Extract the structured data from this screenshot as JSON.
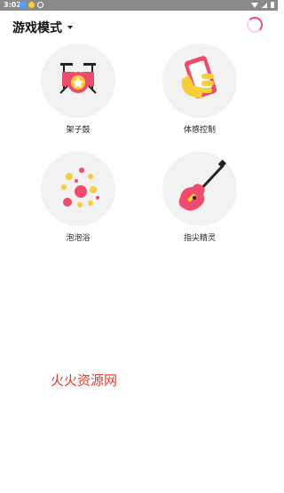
{
  "status_bar": {
    "time": "3:02"
  },
  "header": {
    "title": "游戏模式"
  },
  "modes": [
    {
      "label": "架子鼓",
      "icon": "drum-kit-icon"
    },
    {
      "label": "体感控制",
      "icon": "phone-in-hand-icon"
    },
    {
      "label": "泡泡浴",
      "icon": "bubbles-icon"
    },
    {
      "label": "指尖精灵",
      "icon": "guitar-icon"
    }
  ],
  "watermark": "火火资源网",
  "colors": {
    "accent": "#ef4b6c",
    "yellow": "#f7cd3a",
    "icon_bg": "#f2f2f2"
  }
}
